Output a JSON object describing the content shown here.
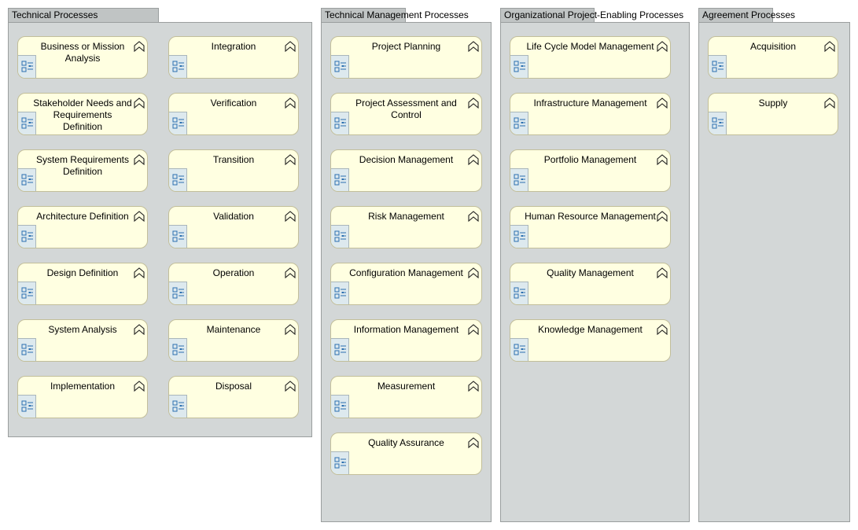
{
  "groups": [
    {
      "title": "Technical Processes",
      "processes": [
        "Business or Mission Analysis",
        "Stakeholder Needs and Requirements Definition",
        "System Requirements Definition",
        "Architecture Definition",
        "Design Definition",
        "System Analysis",
        "Implementation",
        "Integration",
        "Verification",
        "Transition",
        "Validation",
        "Operation",
        "Maintenance",
        "Disposal"
      ]
    },
    {
      "title": "Technical Management Processes",
      "processes": [
        "Project Planning",
        "Project Assessment and Control",
        "Decision Management",
        "Risk Management",
        "Configuration Management",
        "Information Management",
        "Measurement",
        "Quality Assurance"
      ]
    },
    {
      "title": "Organizational Project-Enabling Processes",
      "processes": [
        "Life Cycle Model Management",
        "Infrastructure Management",
        "Portfolio Management",
        "Human Resource Management",
        "Quality Management",
        "Knowledge Management"
      ]
    },
    {
      "title": "Agreement Processes",
      "processes": [
        "Acquisition",
        "Supply"
      ]
    }
  ],
  "colors": {
    "card_fill": "#ffffe1",
    "group_fill": "#d3d7d7",
    "tab_fill": "#c0c4c4",
    "icon_fill": "#dde9ee",
    "icon_stroke": "#2a6fb0"
  },
  "icons": {
    "element": "process-element-icon",
    "collapse": "collapse-chevron-icon"
  }
}
